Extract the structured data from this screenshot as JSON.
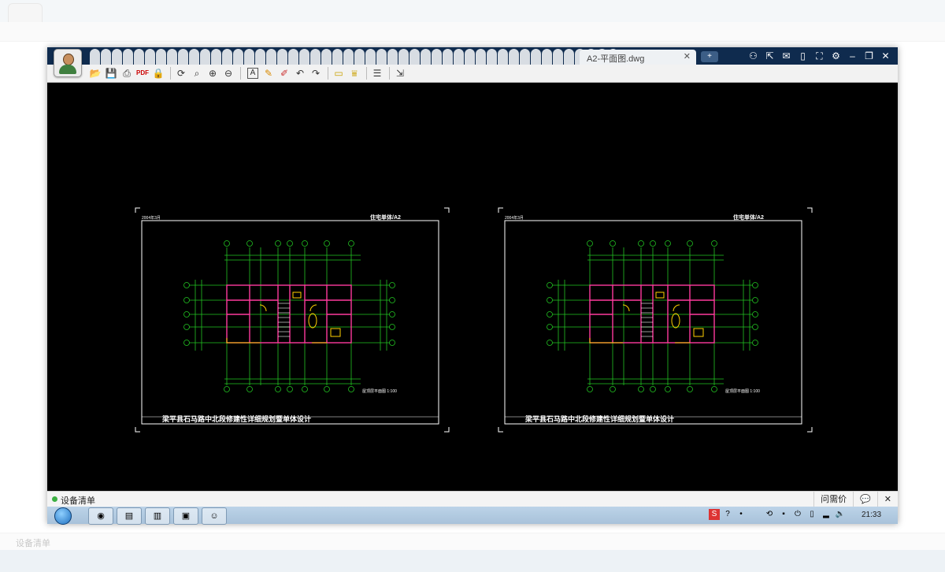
{
  "document": {
    "tab_title": "A2-平面图.dwg"
  },
  "toolbar": {
    "icons": [
      "open-icon",
      "save-icon",
      "print-icon",
      "pdf-icon",
      "lock-icon",
      "refresh-icon",
      "zoom-window-icon",
      "zoom-in-icon",
      "zoom-out-icon",
      "text-icon",
      "pen-icon",
      "highlight-icon",
      "undo-icon",
      "redo-icon",
      "measure-icon",
      "dimension-icon",
      "layers-icon",
      "export-icon"
    ]
  },
  "drawing": {
    "date_label": "2004年3月",
    "sheet_title": "住宅单体/A2",
    "main_title": "梁平县石马路中北段修建性详细规划暨单体设计",
    "plan_title": "屋顶层平面图 1:100"
  },
  "statusbar": {
    "list_label": "设备清单",
    "feedback_label": "问需价",
    "close_glyph": "✕"
  },
  "taskbar": {
    "clock": "21:33"
  },
  "colors": {
    "canvas": "#000000",
    "axis": "#22c522",
    "wall": "#ff3a9e",
    "door": "#ffd000",
    "frame": "#ffffff"
  }
}
